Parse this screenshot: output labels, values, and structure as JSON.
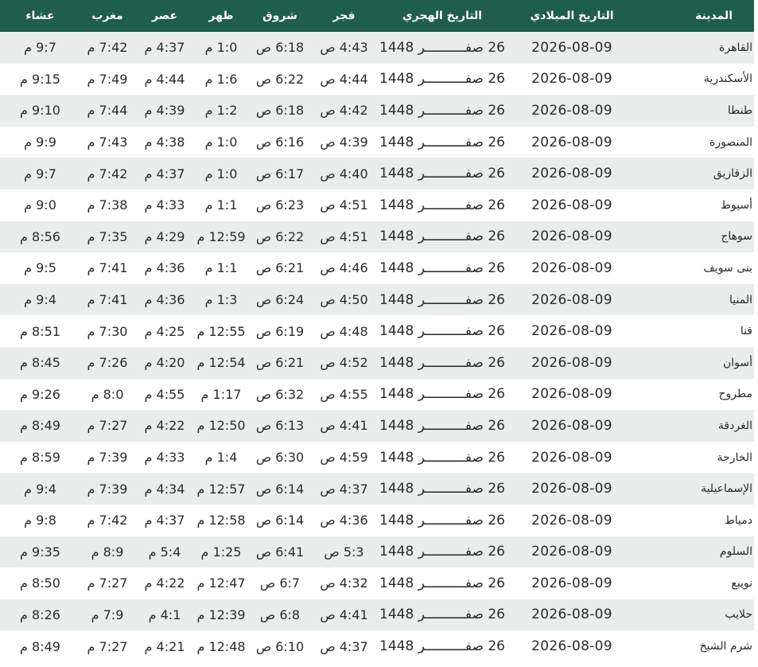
{
  "headers": {
    "city": "المدينة",
    "gregorian": "التاريخ الميلادي",
    "hijri": "التاريخ الهجري",
    "fajr": "فجر",
    "sunrise": "شروق",
    "dhuhr": "ظهر",
    "asr": "عصر",
    "maghrib": "مغرب",
    "isha": "عشاء"
  },
  "rows": [
    {
      "city": "القاهرة",
      "gregorian": "2026-08-09",
      "hijri": "26 صفــــــــــر 1448",
      "fajr": "4:43 ص",
      "sunrise": "6:18 ص",
      "dhuhr": "1:0 م",
      "asr": "4:37 م",
      "maghrib": "7:42 م",
      "isha": "9:7 م"
    },
    {
      "city": "الأسكندرية",
      "gregorian": "2026-08-09",
      "hijri": "26 صفــــــــــر 1448",
      "fajr": "4:44 ص",
      "sunrise": "6:22 ص",
      "dhuhr": "1:6 م",
      "asr": "4:44 م",
      "maghrib": "7:49 م",
      "isha": "9:15 م"
    },
    {
      "city": "طنطا",
      "gregorian": "2026-08-09",
      "hijri": "26 صفــــــــــر 1448",
      "fajr": "4:42 ص",
      "sunrise": "6:18 ص",
      "dhuhr": "1:2 م",
      "asr": "4:39 م",
      "maghrib": "7:44 م",
      "isha": "9:10 م"
    },
    {
      "city": "المنصورة",
      "gregorian": "2026-08-09",
      "hijri": "26 صفــــــــــر 1448",
      "fajr": "4:39 ص",
      "sunrise": "6:16 ص",
      "dhuhr": "1:0 م",
      "asr": "4:38 م",
      "maghrib": "7:43 م",
      "isha": "9:9 م"
    },
    {
      "city": "الزقازيق",
      "gregorian": "2026-08-09",
      "hijri": "26 صفــــــــــر 1448",
      "fajr": "4:40 ص",
      "sunrise": "6:17 ص",
      "dhuhr": "1:0 م",
      "asr": "4:37 م",
      "maghrib": "7:42 م",
      "isha": "9:7 م"
    },
    {
      "city": "أسيوط",
      "gregorian": "2026-08-09",
      "hijri": "26 صفــــــــــر 1448",
      "fajr": "4:51 ص",
      "sunrise": "6:23 ص",
      "dhuhr": "1:1 م",
      "asr": "4:33 م",
      "maghrib": "7:38 م",
      "isha": "9:0 م"
    },
    {
      "city": "سوهاج",
      "gregorian": "2026-08-09",
      "hijri": "26 صفــــــــــر 1448",
      "fajr": "4:51 ص",
      "sunrise": "6:22 ص",
      "dhuhr": "12:59 م",
      "asr": "4:29 م",
      "maghrib": "7:35 م",
      "isha": "8:56 م"
    },
    {
      "city": "بنى سويف",
      "gregorian": "2026-08-09",
      "hijri": "26 صفــــــــــر 1448",
      "fajr": "4:46 ص",
      "sunrise": "6:21 ص",
      "dhuhr": "1:1 م",
      "asr": "4:36 م",
      "maghrib": "7:41 م",
      "isha": "9:5 م"
    },
    {
      "city": "المنيا",
      "gregorian": "2026-08-09",
      "hijri": "26 صفــــــــــر 1448",
      "fajr": "4:50 ص",
      "sunrise": "6:24 ص",
      "dhuhr": "1:3 م",
      "asr": "4:36 م",
      "maghrib": "7:41 م",
      "isha": "9:4 م"
    },
    {
      "city": "قنا",
      "gregorian": "2026-08-09",
      "hijri": "26 صفــــــــــر 1448",
      "fajr": "4:48 ص",
      "sunrise": "6:19 ص",
      "dhuhr": "12:55 م",
      "asr": "4:25 م",
      "maghrib": "7:30 م",
      "isha": "8:51 م"
    },
    {
      "city": "أسوان",
      "gregorian": "2026-08-09",
      "hijri": "26 صفــــــــــر 1448",
      "fajr": "4:52 ص",
      "sunrise": "6:21 ص",
      "dhuhr": "12:54 م",
      "asr": "4:20 م",
      "maghrib": "7:26 م",
      "isha": "8:45 م"
    },
    {
      "city": "مطروح",
      "gregorian": "2026-08-09",
      "hijri": "26 صفــــــــــر 1448",
      "fajr": "4:55 ص",
      "sunrise": "6:32 ص",
      "dhuhr": "1:17 م",
      "asr": "4:55 م",
      "maghrib": "8:0 م",
      "isha": "9:26 م"
    },
    {
      "city": "الغردقة",
      "gregorian": "2026-08-09",
      "hijri": "26 صفــــــــــر 1448",
      "fajr": "4:41 ص",
      "sunrise": "6:13 ص",
      "dhuhr": "12:50 م",
      "asr": "4:22 م",
      "maghrib": "7:27 م",
      "isha": "8:49 م"
    },
    {
      "city": "الخارجة",
      "gregorian": "2026-08-09",
      "hijri": "26 صفــــــــــر 1448",
      "fajr": "4:59 ص",
      "sunrise": "6:30 ص",
      "dhuhr": "1:4 م",
      "asr": "4:33 م",
      "maghrib": "7:39 م",
      "isha": "8:59 م"
    },
    {
      "city": "الإسماعيلية",
      "gregorian": "2026-08-09",
      "hijri": "26 صفــــــــــر 1448",
      "fajr": "4:37 ص",
      "sunrise": "6:14 ص",
      "dhuhr": "12:57 م",
      "asr": "4:34 م",
      "maghrib": "7:39 م",
      "isha": "9:4 م"
    },
    {
      "city": "دمياط",
      "gregorian": "2026-08-09",
      "hijri": "26 صفــــــــــر 1448",
      "fajr": "4:36 ص",
      "sunrise": "6:14 ص",
      "dhuhr": "12:58 م",
      "asr": "4:37 م",
      "maghrib": "7:42 م",
      "isha": "9:8 م"
    },
    {
      "city": "السلوم",
      "gregorian": "2026-08-09",
      "hijri": "26 صفــــــــــر 1448",
      "fajr": "5:3 ص",
      "sunrise": "6:41 ص",
      "dhuhr": "1:25 م",
      "asr": "5:4 م",
      "maghrib": "8:9 م",
      "isha": "9:35 م"
    },
    {
      "city": "نويبع",
      "gregorian": "2026-08-09",
      "hijri": "26 صفــــــــــر 1448",
      "fajr": "4:32 ص",
      "sunrise": "6:7 ص",
      "dhuhr": "12:47 م",
      "asr": "4:22 م",
      "maghrib": "7:27 م",
      "isha": "8:50 م"
    },
    {
      "city": "حلايب",
      "gregorian": "2026-08-09",
      "hijri": "26 صفــــــــــر 1448",
      "fajr": "4:41 ص",
      "sunrise": "6:8 ص",
      "dhuhr": "12:39 م",
      "asr": "4:1 م",
      "maghrib": "7:9 م",
      "isha": "8:26 م"
    },
    {
      "city": "شرم الشيخ",
      "gregorian": "2026-08-09",
      "hijri": "26 صفــــــــــر 1448",
      "fajr": "4:37 ص",
      "sunrise": "6:10 ص",
      "dhuhr": "12:48 م",
      "asr": "4:21 م",
      "maghrib": "7:27 م",
      "isha": "8:49 م"
    }
  ]
}
